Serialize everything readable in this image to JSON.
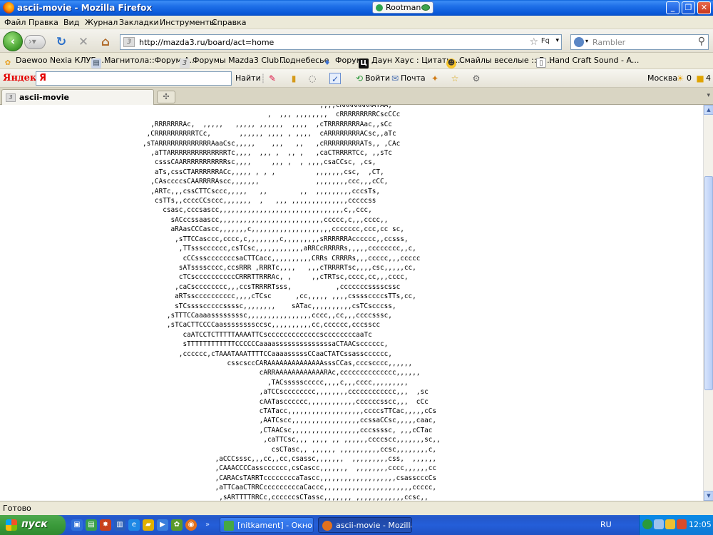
{
  "window": {
    "title": "ascii-movie - Mozilla Firefox",
    "user_badge": "Rootman"
  },
  "menu": [
    "Файл",
    "Правка",
    "Вид",
    "Журнал",
    "Закладки",
    "Инструменты",
    "Справка"
  ],
  "nav": {
    "url": "http://mazda3.ru/board/act=home",
    "feed_label": "Fq",
    "search_placeholder": "Rambler"
  },
  "bookmarks": [
    "Daewoo Nexia КЛУБ -...",
    "Магнитола::Форум A...",
    "Форумы Mazda3 Club ...",
    "Поднебесье",
    "Форум",
    "Даун Хаус : Цитаты ...",
    "Смайлы веселые :: Б...",
    "Hand Craft Sound - A..."
  ],
  "yandex": {
    "logo": "Яндекс",
    "find_label": "Найти",
    "login_label": "Войти",
    "mail_label": "Почта",
    "city": "Москва",
    "weather_count": "0",
    "notif_count": "4"
  },
  "tab": {
    "label": "ascii-movie"
  },
  "content": {
    "ascii_art": "                                            ,,,,cRRRRRRRRATAA,\n                               ,  ,,, ,,,,,,,,  cRRRRRRRRRCscCCc\n  ,RRRRRRRAc,  ,,,,,   ,,,,, ,,,,,,  ,,,,  ,cTRRRRRRRRAac,,sCc\n ,CRRRRRRRRRRTCc,       ,,,,,, ,,,, , ,,,,  cARRRRRRRRACsc,,aTc\n,sTARRRRRRRRRRRRRAaaCsc,,,,,    ,,,   ,,   ,cRRRRRRRRRATs,, ,CAc\n  ,aTTARRRRRRRRRRRRRRTc,,,,  ,,, ,  ,, ,   ,caCTRRRRTCc, ,,sTc\n   csssCAARRRRRRRRRRRsc,,,,     ,,, ,  , ,,,,csaCCsc, ,cs,\n   aTs,cssCTARRRRRRACc,,,,, , , ,          ,,,,,,,csc,  ,CT,\n  ,CAsccccsCAARRRRAscc,,,,,,,              ,,,,,,,,ccc,,,cCC,\n  ,ARTc,,,cssCTTCsccc,,,,,   ,,        ,,  ,,,,,,,,,cccsTs,\n   csTTs,,ccccCCsccc,,,,,,,  ,   ,,, ,,,,,,,,,,,,,,cccccss\n     csasc,cccsascc,,,,,,,,,,,,,,,,,,,,,,,,,,,,,,,c,,ccc,\n       sACccssaascc,,,,,,,,,,,,,,,,,,,,,,,,,,ccccc,c,,,cccc,,\n       aRAasCCCascc,,,,,,,c,,,,,,,,,,,,,,,,,,,,ccccccc,ccc,cc sc,\n        ,sTTCCasccc,cccc,c,,,,,,,,c,,,,,,,,,sRRRRRRAcccccc,,ccsss,\n         ,TTssscccccc,csTCsc,,,,,,,,,,,,aRRCcRRRRRs,,,,,cccccccc,,c,\n          cCCssscccccccsaCTTCacc,,,,,,,,,,CRRs CRRRRs,,,ccccc,,,ccccc\n         sATsssscccc,ccsRRR ,RRRTc,,,,   ,,,cTRRRRTsc,,,,csc,,,,,cc,\n         cTCsccccccccccCRRRTTRRRAc, ,     ,,cTRTsc,cccc,cc,,,cccc,\n        ,caCscccccccc,,,ccsTRRRRTsss,           ,cccccccsssscssc\n        aRTsscccccccccc,,,,cTCsc      ,cc,,,,, ,,,,cssssccccsTTs,cc,\n        sTCsssscccccssssc,,,,,,,,    sATac,,,,,,,,,,csTCscccss,\n      ,sTTTCCaaaassssssssc,,,,,,,,,,,,,,,,cccc,,cc,,,ccccsssc,\n      ,sTCaCTTCCCCaassssssssccsc,,,,,,,,,,cc,cccccc,cccsscc\n          caATCCTCTTTTTAAAATTCscccccccccccccsccccccccaaTc\n          sTTTTTTTTTTTTCCCCCCaaaassssssssssssssaCTAACscccccc,\n         ,cccccc,cTAAATAAATTTTCCaaaasssssCCaaCTATCssasscccccc,\n                     csscsccCARAAAAAAAAAAAAAAsssCCas,cccscccc,,,,,,\n                             cARRAAAAAAAAAAAARAc,cccccccccccccc,,,,,,\n                               ,TACsssssccccc,,,,c,,,cccc,,,,,,,,,\n                             ,aTCCscccccccc,,,,,,,,cccccccccccc,,,  ,sc\n                             cAATascccccc,,,,,,,,,,,,ccccccsscc,,,  cCc\n                             cTATacc,,,,,,,,,,,,,,,,,,,ccccsTTCac,,,,,cCs\n                             ,AATCscc,,,,,,,,,,,,,,,,,ccssaCCsc,,,,,caac,\n                             ,CTAACsc,,,,,,,,,,,,,,,,,cccssssc, ,,,cCTac\n                              ,caTTCsc,,, ,,,, ,, ,,,,,,ccccscc,,,,,,,sc,,\n                                csCTasc,, ,,,,,, ,,,,,,,,,,ccsc,,,,,,,,c,\n                  ,aCCCsssc,,,cc,,cc,csassc,,,,,,,  ,,,,,,,,,css,  ,,,,,,\n                  ,CAAACCCCasscccccc,csCascc,,,,,,,  ,,,,,,,,cccc,,,,,,cc\n                  ,CARACsTARRTccccccccaTascc,,,,,,,,,,,,,,,,,,,csasscccCs\n                  ,aTTCaaCTRRCcccccccccaCaccc,,,,,,,,,,,,,,,,,,,,,,ccccc,\n                   ,sARTTTTRRCc,ccccccsCTassc,,,,,,, ,,,,,,,,,,,,ccsc,,\n                     cccccsCTTCsssCCs,,sTCssc,,,,,,,,,,,,,,,,,,,,,ccsc,\n                        ,,,,,,cccs,  sTCsscc,,,,,,,,,,,,,,,,,,,,,,cc,,\n                                     sTTsscc,,,,,,,, ,,,,,,,,,,,cc,"
  },
  "status": "Готово",
  "taskbar": {
    "start_label": "пуск",
    "buttons": [
      "[nitkament] - Окно с...",
      "ascii-movie - Mozilla Fi..."
    ],
    "lang": "RU",
    "clock": "12:05"
  }
}
